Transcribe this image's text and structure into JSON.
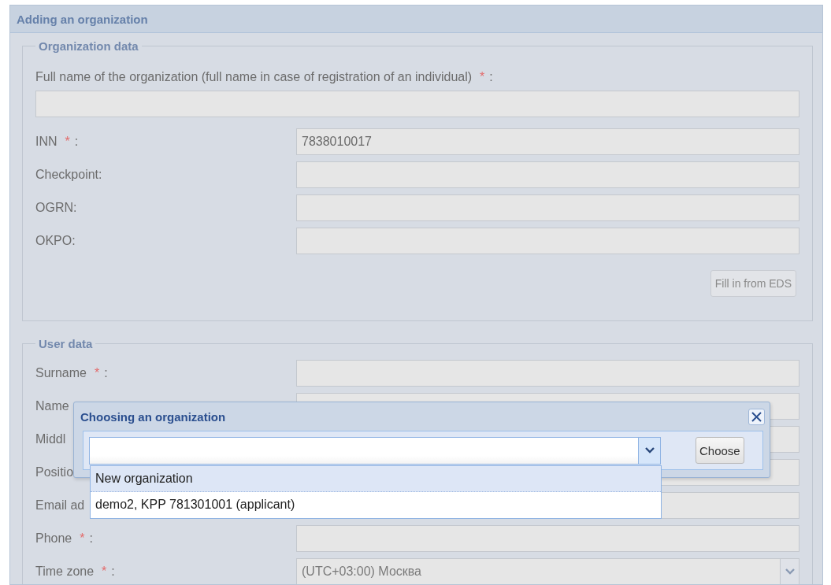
{
  "window": {
    "title": "Adding an organization"
  },
  "organization_data": {
    "legend": "Organization data",
    "full_name": {
      "label": "Full name of the organization (full name in case of registration of an individual)",
      "required_mark": "*",
      "colon": ":"
    },
    "fields": [
      {
        "label": "INN",
        "required_mark": "*",
        "colon": ":",
        "value": "7838010017"
      },
      {
        "label": "Checkpoint:"
      },
      {
        "label": "OGRN:"
      },
      {
        "label": "OKPO:"
      }
    ],
    "fill_button": "Fill in from EDS"
  },
  "user_data": {
    "legend": "User data",
    "fields": [
      {
        "label": "Surname",
        "required_mark": "*",
        "colon": ":",
        "kind": "text"
      },
      {
        "label": "Name",
        "kind": "text"
      },
      {
        "label": "Middl",
        "kind": "text"
      },
      {
        "label": "Positio",
        "kind": "text"
      },
      {
        "label": "Email ad",
        "kind": "text"
      },
      {
        "label": "Phone",
        "required_mark": "*",
        "colon": ":",
        "kind": "text"
      },
      {
        "label": "Time zone",
        "required_mark": "*",
        "colon": ":",
        "kind": "combo",
        "value": "(UTC+03:00) Москва"
      }
    ]
  },
  "dialog": {
    "title": "Choosing an organization",
    "choose_button": "Choose",
    "options": [
      {
        "label": "New organization",
        "selected": true
      },
      {
        "label": "demo2, KPP 781301001 (applicant)",
        "selected": false
      }
    ]
  }
}
